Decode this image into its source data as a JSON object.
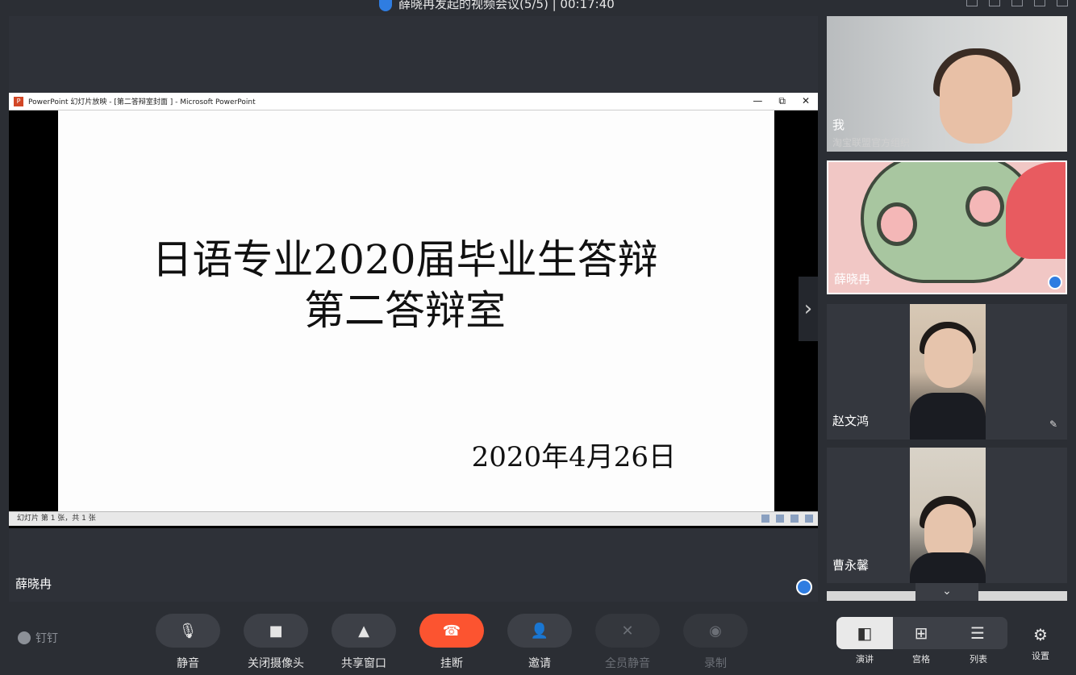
{
  "window": {
    "title": "薛晓冉发起的视频会议(5/5) | 00:17:40"
  },
  "ppt": {
    "window_title": "PowerPoint 幻灯片放映 - [第二答辩室封面 ] - Microsoft PowerPoint",
    "slide_title_1": "日语专业2020届毕业生答辩",
    "slide_title_2": "第二答辩室",
    "slide_date": "2020年4月26日",
    "status_text": "幻灯片 第 1 张，共 1 张",
    "minimize": "—",
    "restore": "⧉",
    "close": "✕"
  },
  "stage": {
    "presenter_name": "薛晓冉"
  },
  "participants": [
    {
      "name": "我",
      "subtitle": "淘宝联盟官方组织"
    },
    {
      "name": "薛晓冉"
    },
    {
      "name": "赵文鸿"
    },
    {
      "name": "曹永馨"
    }
  ],
  "brand": {
    "label": "钉钉"
  },
  "toolbar": {
    "mute": "静音",
    "camera_off": "关闭摄像头",
    "share_window": "共享窗口",
    "hang_up": "挂断",
    "invite": "邀请",
    "mute_all": "全员静音",
    "record": "录制"
  },
  "layout": {
    "speaker": "演讲",
    "grid": "宫格",
    "list": "列表"
  },
  "settings": {
    "label": "设置"
  },
  "icons": {
    "mic": "🎙",
    "camera": "■",
    "share": "▲",
    "phone": "☎",
    "invite": "👤",
    "mute_all": "✕",
    "record": "◉",
    "speaker_view": "◧",
    "grid_view": "⊞",
    "list_view": "☰",
    "gear": "⚙",
    "chevron_right": "›",
    "chevron_down": "⌄",
    "mic_off": "✎"
  },
  "colors": {
    "accent": "#2f7de1",
    "hangup": "#fc5430",
    "background": "#2b2e34"
  }
}
